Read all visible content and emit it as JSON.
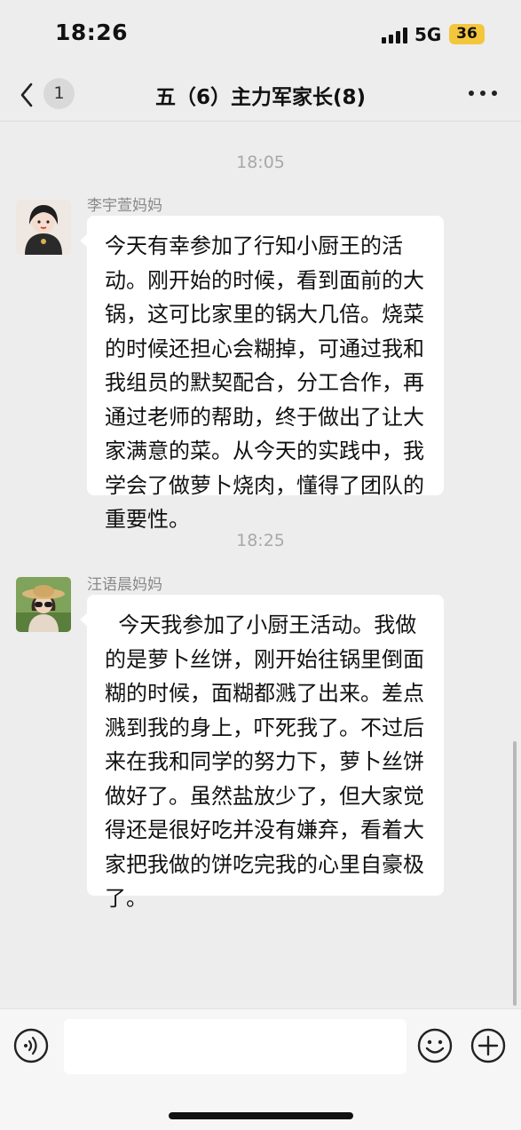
{
  "status_bar": {
    "time": "18:26",
    "network": "5G",
    "battery": "36"
  },
  "header": {
    "unread_count": "1",
    "title": "五（6）主力军家长(8)"
  },
  "messages": [
    {
      "timestamp": "18:05",
      "sender": "李宇萱妈妈",
      "text": "今天有幸参加了行知小厨王的活动。刚开始的时候，看到面前的大锅，这可比家里的锅大几倍。烧菜的时候还担心会糊掉，可通过我和我组员的默契配合，分工合作，再通过老师的帮助，终于做出了让大家满意的菜。从今天的实践中，我学会了做萝卜烧肉，懂得了团队的重要性。"
    },
    {
      "timestamp": "18:25",
      "sender": "汪语晨妈妈",
      "text": "  今天我参加了小厨王活动。我做的是萝卜丝饼，刚开始往锅里倒面糊的时候，面糊都溅了出来。差点溅到我的身上，吓死我了。不过后来在我和同学的努力下，萝卜丝饼做好了。虽然盐放少了，但大家觉得还是很好吃并没有嫌弃，看着大家把我做的饼吃完我的心里自豪极了。"
    }
  ],
  "input_bar": {
    "text_value": "",
    "icons": [
      "voice-icon",
      "emoji-icon",
      "plus-icon"
    ]
  },
  "colors": {
    "background": "#ededed",
    "bubble": "#ffffff",
    "battery": "#f3c63c",
    "timestamp": "#a8a8a8"
  }
}
